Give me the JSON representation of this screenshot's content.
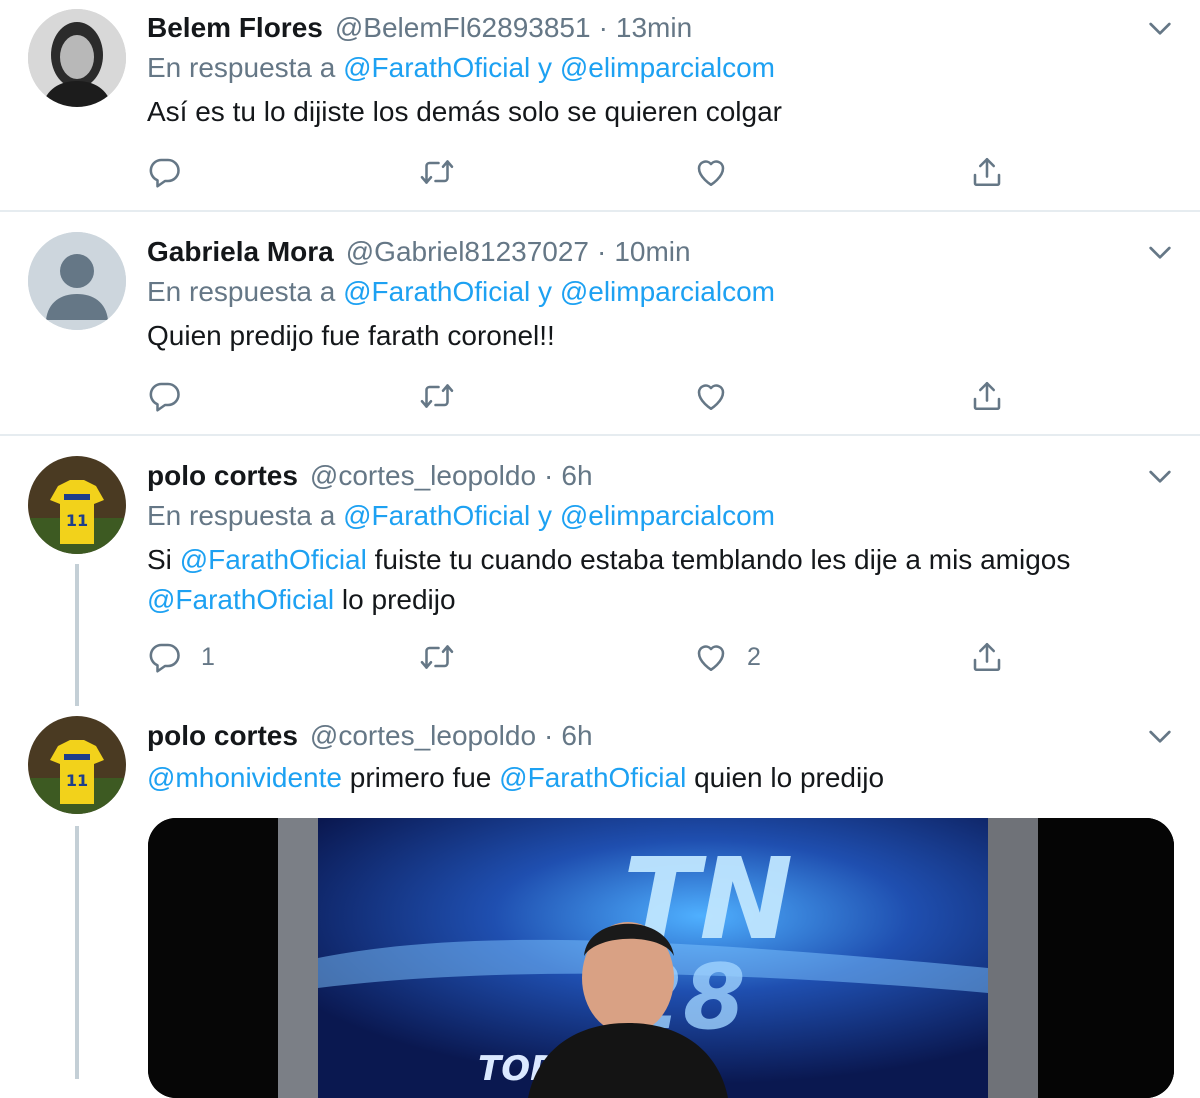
{
  "tweets": [
    {
      "name": "Belem Flores",
      "handle": "@BelemFl62893851",
      "time": "13min",
      "reply_prefix": "En respuesta a",
      "reply_mention_1": "@FarathOficial",
      "reply_joiner": "y",
      "reply_mention_2": "@elimparcialcom",
      "text": "Así es tu lo dijiste los demás solo se quieren colgar",
      "reply_count": "",
      "like_count": ""
    },
    {
      "name": "Gabriela Mora",
      "handle": "@Gabriel81237027",
      "time": "10min",
      "reply_prefix": "En respuesta a",
      "reply_mention_1": "@FarathOficial",
      "reply_joiner": "y",
      "reply_mention_2": "@elimparcialcom",
      "text": "Quien predijo fue farath coronel!!",
      "reply_count": "",
      "like_count": ""
    },
    {
      "name": "polo cortes",
      "handle": "@cortes_leopoldo",
      "time": "6h",
      "reply_prefix": "En respuesta a",
      "reply_mention_1": "@FarathOficial",
      "reply_joiner": "y",
      "reply_mention_2": "@elimparcialcom",
      "text_part_1": "Si",
      "text_mention_1": "@FarathOficial",
      "text_part_2": "fuiste tu cuando estaba temblando les dije a mis amigos",
      "text_mention_2": "@FarathOficial",
      "text_part_3": "lo predijo",
      "reply_count": "1",
      "like_count": "2"
    },
    {
      "name": "polo cortes",
      "handle": "@cortes_leopoldo",
      "time": "6h",
      "text_mention_1": "@mhonividente",
      "text_part_1": "primero fue",
      "text_mention_2": "@FarathOficial",
      "text_part_2": "quien lo predijo",
      "media_logo_text": "TN",
      "media_logo_num": "28",
      "media_caption": "TOD"
    }
  ],
  "separator_dot": "·",
  "colors": {
    "link": "#1da1f2",
    "secondary_text": "#657786",
    "divider": "#e6ecf0",
    "thread_line": "#c4cfd6"
  },
  "icons": [
    "reply-icon",
    "retweet-icon",
    "like-icon",
    "share-icon",
    "chevron-down-icon"
  ]
}
